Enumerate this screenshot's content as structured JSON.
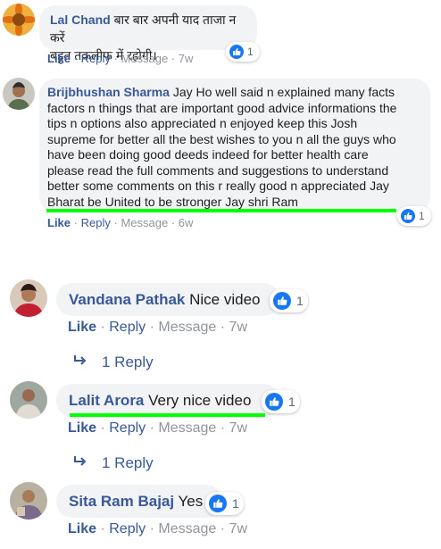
{
  "comments": [
    {
      "author": "Lal Chand",
      "text_line1": "बार बार अपनी याद ताजा न करें",
      "text_line2": "बहुत तकलीफ में रहोगी।",
      "like": "Like",
      "reply": "Reply",
      "message": "Message",
      "sep": "·",
      "time": "7w",
      "reactions": "1"
    },
    {
      "author": "Brijbhushan Sharma",
      "lines": [
        "Jay Ho well said n explained many facts",
        "factors n things that are important good advice informations the",
        "tips n options also appreciated n enjoyed keep this Josh",
        "supreme for better all the best wishes to you n all the guys who",
        "have been doing good deeds indeed for better health care",
        "please read the full comments and suggestions to understand",
        "better some comments on this r really good n appreciated Jay",
        "Bharat be United to be stronger Jay shri Ram"
      ],
      "like": "Like",
      "reply": "Reply",
      "message": "Message",
      "sep": "·",
      "time": "6w",
      "reactions": "1"
    },
    {
      "author": "Vandana Pathak",
      "text": "Nice video",
      "like": "Like",
      "reply": "Reply",
      "message": "Message",
      "sep": "·",
      "time": "7w",
      "reactions": "1",
      "replies": "1 Reply"
    },
    {
      "author": "Lalit Arora",
      "text": "Very nice video",
      "like": "Like",
      "reply": "Reply",
      "message": "Message",
      "sep": "·",
      "time": "7w",
      "reactions": "1",
      "replies": "1 Reply"
    },
    {
      "author": "Sita Ram Bajaj",
      "text": "Yes",
      "like": "Like",
      "reply": "Reply",
      "message": "Message",
      "sep": "·",
      "time": "7w",
      "reactions": "1"
    }
  ],
  "colors": {
    "name": "#385898",
    "bubble": "#f2f3f5",
    "like_blue": "#1877f2",
    "highlight": "#00ff00",
    "meta": "#90949c"
  },
  "icons": {
    "reaction": "thumbs-up-icon",
    "reply_arrow": "reply-arrow-icon"
  }
}
